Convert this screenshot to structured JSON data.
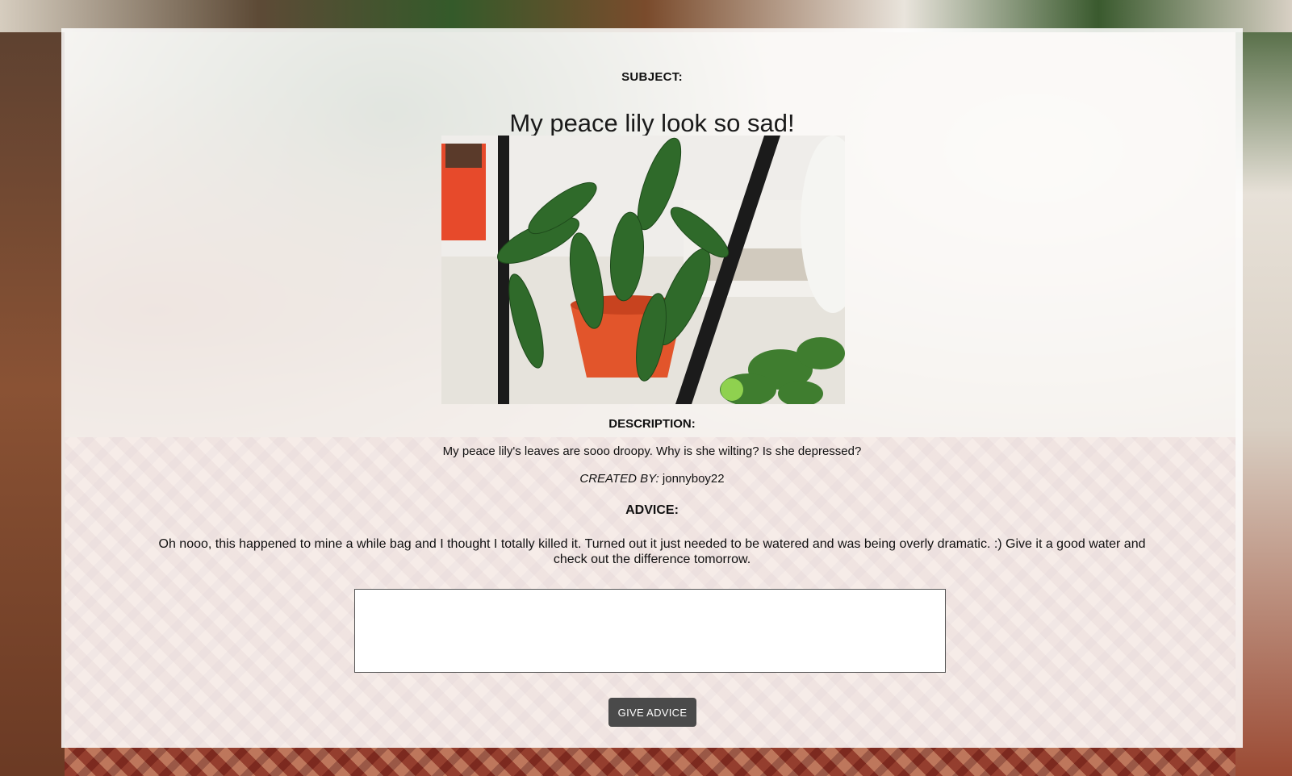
{
  "subject": {
    "label": "SUBJECT:",
    "title": "My peace lily look so sad!"
  },
  "photo": {
    "alt": "Drooping peace lily in an orange pot"
  },
  "description": {
    "label": "DESCRIPTION:",
    "text": "My peace lily's leaves are sooo droopy. Why is she wilting? Is she depressed?"
  },
  "created_by": {
    "label": "CREATED BY:",
    "user": "jonnyboy22"
  },
  "advice": {
    "label": "ADVICE:",
    "items": [
      "Oh nooo, this happened to mine a while bag and I thought I totally killed it. Turned out it just needed to be watered and was being overly dramatic. :) Give it a good water and check out the difference tomorrow."
    ],
    "input_value": "",
    "submit_label": "GIVE ADVICE"
  },
  "colors": {
    "button_bg": "#4a4a4a",
    "card_bg": "#ffffff",
    "pot": "#e2552b",
    "leaf": "#2f6a2a"
  },
  "icons": {
    "background": "living-room-background",
    "photo": "plant-photo"
  }
}
